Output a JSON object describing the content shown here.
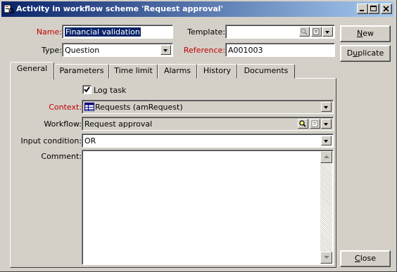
{
  "window": {
    "title": "Activity in workflow scheme 'Request approval'",
    "controls": [
      "minimize",
      "maximize",
      "close"
    ]
  },
  "header": {
    "name_label": "Name:",
    "name_value": "Financial validation",
    "template_label": "Template:",
    "template_value": "",
    "type_label": "Type:",
    "type_value": "Question",
    "reference_label": "Reference:",
    "reference_value": "A001003"
  },
  "buttons": {
    "new": {
      "mnemonic": "N",
      "rest": "ew"
    },
    "duplicate": {
      "before": "D",
      "mnemonic": "u",
      "rest": "plicate"
    },
    "close": {
      "mnemonic": "C",
      "rest": "lose"
    }
  },
  "tabs": [
    "General",
    "Parameters",
    "Time limit",
    "Alarms",
    "History",
    "Documents"
  ],
  "active_tab": "General",
  "general": {
    "log_task_label": "Log task",
    "log_task_checked": true,
    "context_label": "Context:",
    "context_value": "Requests (amRequest)",
    "workflow_label": "Workflow:",
    "workflow_value": "Request approval",
    "input_condition_label": "Input condition:",
    "input_condition_value": "OR",
    "comment_label": "Comment:",
    "comment_value": ""
  },
  "colors": {
    "title_gradient_start": "#0a246a",
    "title_gradient_end": "#a6caf0",
    "required_label": "#c00000",
    "face": "#d4d0c8",
    "selection": "#0a246a"
  }
}
